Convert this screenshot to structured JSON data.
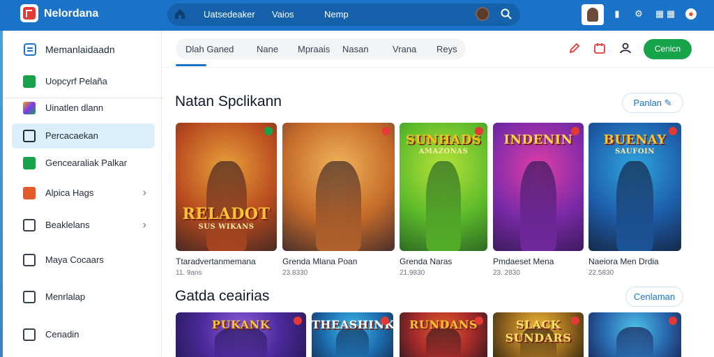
{
  "header": {
    "app_title": "Nelordana",
    "nav_links": [
      "Uatsedeaker",
      "Vaios",
      "Nemp"
    ],
    "brand_color": "#1a73c9"
  },
  "sidebar": {
    "brand_label": "Memanlaidaadn",
    "items": [
      {
        "label": "Uopcyrf Pelaña",
        "icon": "check-square-icon",
        "color": "#16a34a",
        "active": false,
        "chevron": false
      },
      {
        "label": "Uinatlen dlann",
        "icon": "palette-icon",
        "color": "#7c3aed",
        "active": false,
        "chevron": false
      },
      {
        "label": "Percacaekan",
        "icon": "compass-icon",
        "color": "#1f2937",
        "active": true,
        "chevron": false
      },
      {
        "label": "Gencearaliak Palkar",
        "icon": "gamepad-icon",
        "color": "#16a34a",
        "active": false,
        "chevron": false
      },
      {
        "label": "Alpica Hags",
        "icon": "mail-icon",
        "color": "#e55a2b",
        "active": false,
        "chevron": true
      },
      {
        "label": "Beaklelans",
        "icon": "picture-icon",
        "color": "#374151",
        "active": false,
        "chevron": true
      },
      {
        "label": "Maya Cocaars",
        "icon": "chat-icon",
        "color": "#374151",
        "active": false,
        "chevron": false
      },
      {
        "label": "Menrlalap",
        "icon": "shield-icon",
        "color": "#374151",
        "active": false,
        "chevron": false
      },
      {
        "label": "Cenadin",
        "icon": "gear-icon",
        "color": "#374151",
        "active": false,
        "chevron": false
      }
    ]
  },
  "tabs": [
    "Dlah Ganed",
    "Nane",
    "Mpraais",
    "Nasan",
    "Vrana",
    "Reys"
  ],
  "actions": {
    "cta_label": "Cenicn",
    "cta_color": "#16a34a"
  },
  "sections": [
    {
      "title": "Natan Spclikann",
      "button_label": "Panlan",
      "games": [
        {
          "name": "Ttaradvertanmemana",
          "meta": "11. 9ans",
          "art_title": "RELADOT",
          "art_subtitle": "SUS WIKANS",
          "art_colors": [
            "#e8a13a",
            "#b84a1f",
            "#4b2a22"
          ],
          "title_color": "#f7c531"
        },
        {
          "name": "Grenda Mlana Poan",
          "meta": "23.8330",
          "art_title": "",
          "art_subtitle": "",
          "art_colors": [
            "#f2b55a",
            "#c46a2a",
            "#4a2f2a"
          ],
          "title_color": "#f7c531"
        },
        {
          "name": "Grenda Naras",
          "meta": "21.9830",
          "art_title": "SUNHADS",
          "art_subtitle": "AMAZONAS",
          "art_colors": [
            "#b7e33b",
            "#5dba2a",
            "#2e6b24"
          ],
          "title_color": "#f4c21a"
        },
        {
          "name": "Pmdaeset Mena",
          "meta": "23. 2830",
          "art_title": "INDENIN",
          "art_subtitle": "",
          "art_colors": [
            "#e03da7",
            "#7b2aa8",
            "#3d1b5e"
          ],
          "title_color": "#ffd84a"
        },
        {
          "name": "Naeiora Men Drdia",
          "meta": "22.5830",
          "art_title": "BUENAY",
          "art_subtitle": "SAUFOIN",
          "art_colors": [
            "#2fa5e0",
            "#1d5ca8",
            "#162a4a"
          ],
          "title_color": "#f7c531"
        }
      ]
    },
    {
      "title": "Gatda ceairias",
      "button_label": "Cenlaman",
      "games": [
        {
          "name": "",
          "meta": "",
          "art_title": "PUKANK",
          "art_subtitle": "",
          "art_colors": [
            "#8d5bd8",
            "#4b2a9a",
            "#2a1a5e"
          ],
          "title_color": "#f7c531"
        },
        {
          "name": "",
          "meta": "",
          "art_title": "THEASHINK",
          "art_subtitle": "",
          "art_colors": [
            "#3fb8e8",
            "#1c6fb0",
            "#15345e"
          ],
          "title_color": "#ffffff"
        },
        {
          "name": "",
          "meta": "",
          "art_title": "RUNDANS",
          "art_subtitle": "",
          "art_colors": [
            "#e05a2a",
            "#a42a2a",
            "#3a1a20"
          ],
          "title_color": "#f7c531"
        },
        {
          "name": "",
          "meta": "",
          "art_title": "SLACK SUNDARS",
          "art_subtitle": "",
          "art_colors": [
            "#f1b93a",
            "#9a6a1f",
            "#3a2a12"
          ],
          "title_color": "#ffe066"
        },
        {
          "name": "",
          "meta": "",
          "art_title": "",
          "art_subtitle": "",
          "art_colors": [
            "#4ec2e8",
            "#2a6ab0",
            "#1a2a5e"
          ],
          "title_color": "#f7c531"
        }
      ]
    }
  ]
}
